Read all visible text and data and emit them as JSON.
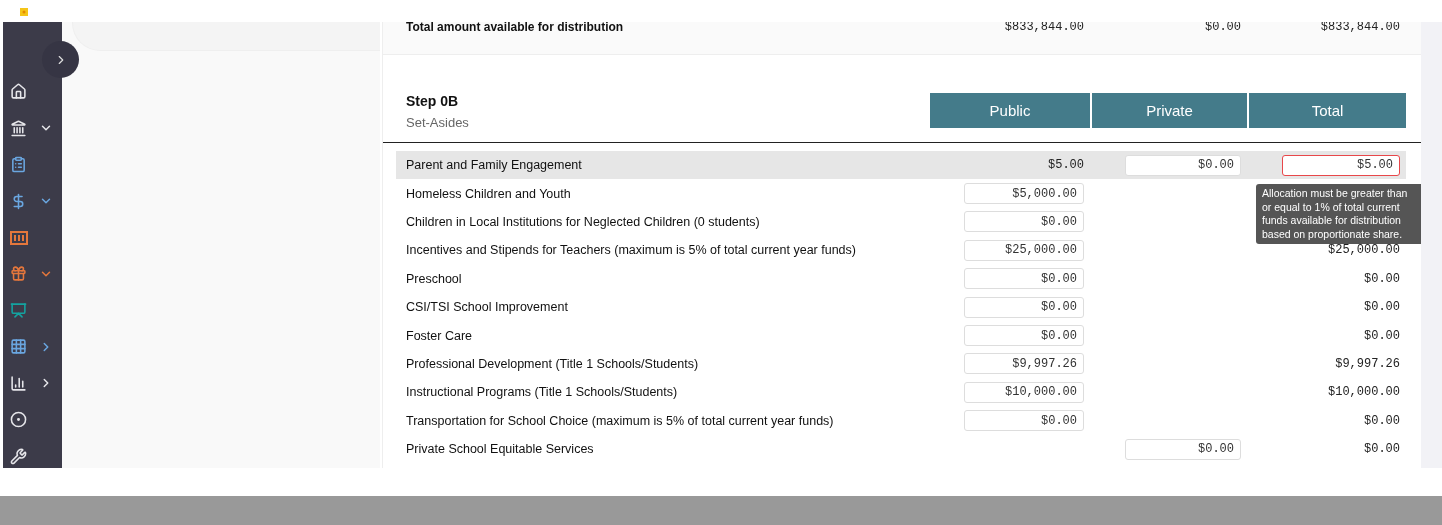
{
  "sidebar": {
    "items": [
      {
        "color": "#e6e6ea"
      },
      {
        "color": "#e6e6ea",
        "expanded": true
      },
      {
        "color": "#6aa6e0"
      },
      {
        "color": "#6aa6e0",
        "expanded": true
      },
      {
        "color": "#e5773c"
      },
      {
        "color": "#e5773c",
        "expanded": true
      },
      {
        "color": "#14a3a0"
      },
      {
        "color": "#6aa6e0",
        "expanded": false
      },
      {
        "color": "#e6e6ea",
        "expanded": false
      },
      {
        "color": "#e6e6ea"
      },
      {
        "color": "#e6e6ea"
      }
    ]
  },
  "summary": {
    "label": "Total amount available for distribution",
    "public": "$833,844.00",
    "private": "$0.00",
    "total": "$833,844.00"
  },
  "step": {
    "title": "Step 0B",
    "subtitle": "Set-Asides",
    "columns": [
      "Public",
      "Private",
      "Total"
    ]
  },
  "rows": [
    {
      "label": "Parent and Family Engagement",
      "highlighted": true,
      "cells": [
        {
          "kind": "text",
          "value": "$5.00"
        },
        {
          "kind": "input",
          "value": "$0.00",
          "invalid": false
        },
        {
          "kind": "input",
          "value": "$5.00",
          "invalid": true
        }
      ]
    },
    {
      "label": "Homeless Children and Youth",
      "highlighted": false,
      "cells": [
        {
          "kind": "input",
          "value": "$5,000.00",
          "invalid": false
        },
        {
          "kind": "none"
        },
        {
          "kind": "none"
        }
      ]
    },
    {
      "label": "Children in Local Institutions for Neglected Children (0 students)",
      "highlighted": false,
      "cells": [
        {
          "kind": "input",
          "value": "$0.00",
          "invalid": false
        },
        {
          "kind": "none"
        },
        {
          "kind": "none"
        }
      ]
    },
    {
      "label": "Incentives and Stipends for Teachers (maximum is 5% of total current year funds)",
      "highlighted": false,
      "cells": [
        {
          "kind": "input",
          "value": "$25,000.00",
          "invalid": false
        },
        {
          "kind": "none"
        },
        {
          "kind": "text",
          "value": "$25,000.00"
        }
      ]
    },
    {
      "label": "Preschool",
      "highlighted": false,
      "cells": [
        {
          "kind": "input",
          "value": "$0.00",
          "invalid": false
        },
        {
          "kind": "none"
        },
        {
          "kind": "text",
          "value": "$0.00"
        }
      ]
    },
    {
      "label": "CSI/TSI School Improvement",
      "highlighted": false,
      "cells": [
        {
          "kind": "input",
          "value": "$0.00",
          "invalid": false
        },
        {
          "kind": "none"
        },
        {
          "kind": "text",
          "value": "$0.00"
        }
      ]
    },
    {
      "label": "Foster Care",
      "highlighted": false,
      "cells": [
        {
          "kind": "input",
          "value": "$0.00",
          "invalid": false
        },
        {
          "kind": "none"
        },
        {
          "kind": "text",
          "value": "$0.00"
        }
      ]
    },
    {
      "label": "Professional Development (Title 1 Schools/Students)",
      "highlighted": false,
      "cells": [
        {
          "kind": "input",
          "value": "$9,997.26",
          "invalid": false
        },
        {
          "kind": "none"
        },
        {
          "kind": "text",
          "value": "$9,997.26"
        }
      ]
    },
    {
      "label": "Instructional Programs (Title 1 Schools/Students)",
      "highlighted": false,
      "cells": [
        {
          "kind": "input",
          "value": "$10,000.00",
          "invalid": false
        },
        {
          "kind": "none"
        },
        {
          "kind": "text",
          "value": "$10,000.00"
        }
      ]
    },
    {
      "label": "Transportation for School Choice (maximum is 5% of total current year funds)",
      "highlighted": false,
      "cells": [
        {
          "kind": "input",
          "value": "$0.00",
          "invalid": false
        },
        {
          "kind": "none"
        },
        {
          "kind": "text",
          "value": "$0.00"
        }
      ]
    },
    {
      "label": "Private School Equitable Services",
      "highlighted": false,
      "cells": [
        {
          "kind": "none"
        },
        {
          "kind": "input",
          "value": "$0.00",
          "invalid": false
        },
        {
          "kind": "text",
          "value": "$0.00"
        }
      ]
    }
  ],
  "tooltip": "Allocation must be greater than or equal to 1% of total current funds available for distribution based on proportionate share."
}
